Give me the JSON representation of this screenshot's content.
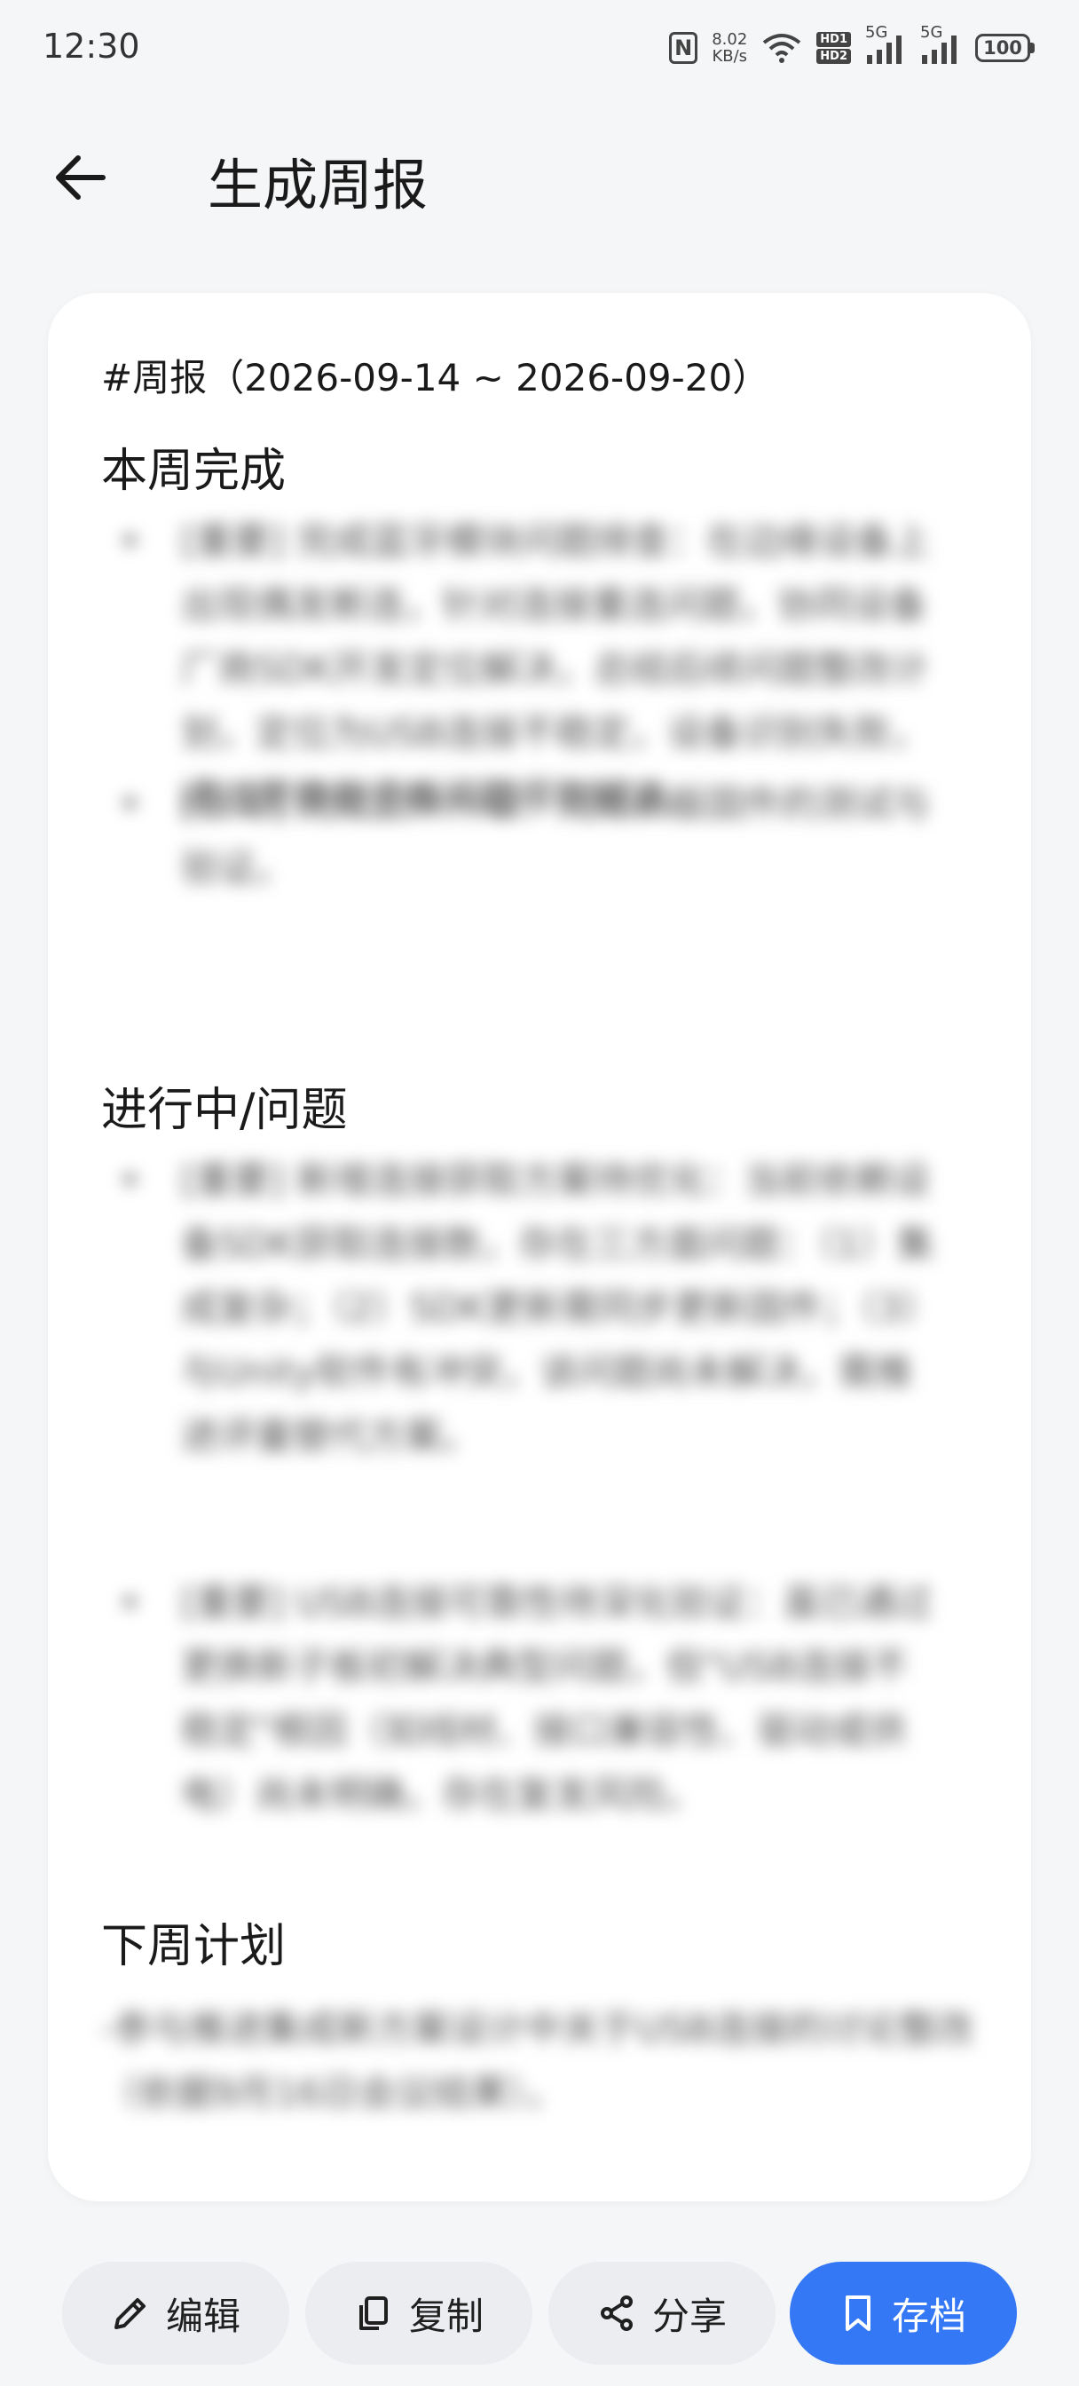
{
  "status_bar": {
    "time": "12:30",
    "net_speed_value": "8.02",
    "net_speed_unit": "KB/s",
    "hd1": "HD1",
    "hd2": "HD2",
    "signal1_gen": "5G",
    "signal2_gen": "5G",
    "battery": "100",
    "nfc": "N"
  },
  "header": {
    "title": "生成周报"
  },
  "report": {
    "heading": "#周报（2026-09-14 ~ 2026-09-20）",
    "sections": [
      {
        "title": "本周完成",
        "items": [
          {
            "bullet": "•",
            "text": "[重要] 完成蓝牙模块问题排查：在边缘设备上出现偶发断连，针对连接重连问题，协同设备厂商SDK开发定位解决，总结后续问题整改计划，定位为USB连接不稳定，设备识别失败，通过更换新子板问题得到解决。"
          },
          {
            "bullet": "•",
            "text": "[日常] 完成固件升级：完成新版固件的测试与验证。"
          }
        ]
      },
      {
        "title": "进行中/问题",
        "items": [
          {
            "bullet": "•",
            "text": "[重要] 新增连接获取方案待优化：当前依赖设备SDK获取连接数，存在三方面问题：（1）集成复杂；（2）SDK更新需同步更新固件；（3）与Unity软件有冲突，该问题尚未解决，需推进评量替代方案。"
          },
          {
            "bullet": "•",
            "text": "[重要] USB连接可靠性待深化验证：虽已通过更换新子板初解决典型问题，但\"USB连接不稳定\"根因（如线材、接口兼容性、驱动或供电）尚未明确，存在复发风险。"
          }
        ]
      },
      {
        "title": "下周计划",
        "items": [
          {
            "bullet": "",
            "text": "-参与推进集成新方案设计中关于USB连接的讨论整改（依据9月16日会议结果）。"
          }
        ]
      }
    ]
  },
  "actions": {
    "edit": "编辑",
    "copy": "复制",
    "share": "分享",
    "archive": "存档"
  },
  "colors": {
    "background": "#f5f6f8",
    "card": "#ffffff",
    "button": "#ebedf1",
    "primary": "#3478f6"
  }
}
